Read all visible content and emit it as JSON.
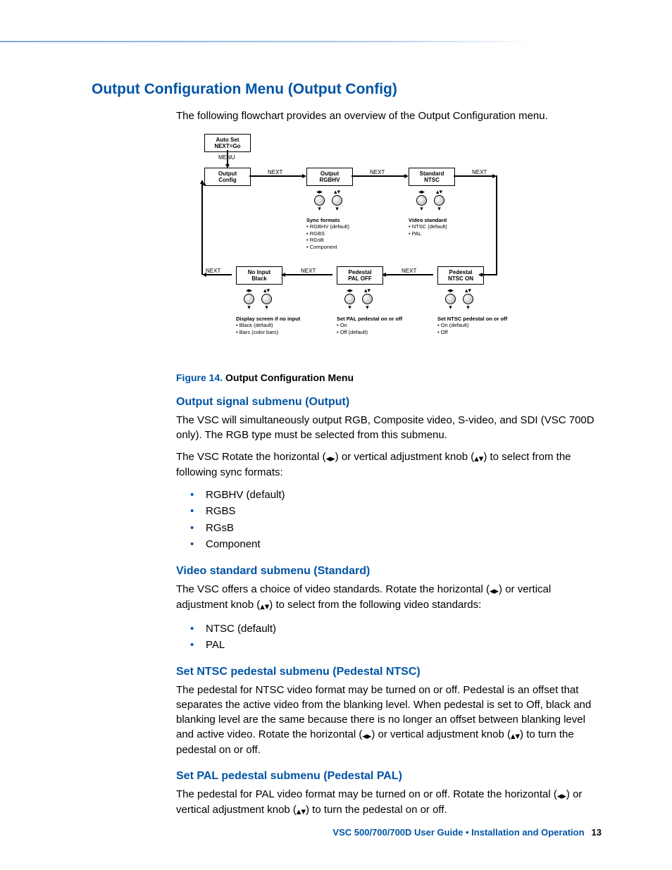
{
  "h1": "Output Configuration Menu (Output Config)",
  "intro": "The following flowchart provides an overview of the Output Configuration menu.",
  "flow": {
    "labels": {
      "next": "NEXT",
      "menu": "MENU"
    },
    "nodes": {
      "autoset": {
        "l1": "Auto Set",
        "l2": "NEXT=Go"
      },
      "output_config": {
        "l1": "Output",
        "l2": "Config"
      },
      "output_rgbhv": {
        "l1": "Output",
        "l2": "RGBHV"
      },
      "standard_ntsc": {
        "l1": "Standard",
        "l2": "NTSC"
      },
      "no_input_black": {
        "l1": "No Input",
        "l2": "Black"
      },
      "pedestal_pal": {
        "l1": "Pedestal",
        "l2": "PAL  OFF"
      },
      "pedestal_ntsc": {
        "l1": "Pedestal",
        "l2": "NTSC  ON"
      }
    },
    "descs": {
      "sync": {
        "title": "Sync formats",
        "items": [
          "RGBHV (default)",
          "RGBS",
          "RGsB",
          "Component"
        ]
      },
      "vstd": {
        "title": "Video standard",
        "items": [
          "NTSC (default)",
          "PAL"
        ]
      },
      "noinput": {
        "title": "Display screen if no input",
        "items": [
          "Black (default)",
          "Bars (color bars)"
        ]
      },
      "ppal": {
        "title": "Set PAL pedestal on or off",
        "items": [
          "On",
          "Off (default)"
        ]
      },
      "pntsc": {
        "title": "Set NTSC pedestal on or off",
        "items": [
          "On (default)",
          "Off"
        ]
      }
    }
  },
  "fig": {
    "lead": "Figure 14. ",
    "title": "Output Configuration Menu"
  },
  "sec1": {
    "h": "Output signal submenu (Output)",
    "p1a": "The VSC will simultaneously output RGB, Composite video, S-video, and SDI (VSC 700D only).  The RGB type must be selected from this submenu.",
    "p2a": "The VSC Rotate the horizontal (",
    "p2b": ") or vertical adjustment knob (",
    "p2c": ") to select from the following sync formats:",
    "items": [
      "RGBHV (default)",
      "RGBS",
      "RGsB",
      "Component"
    ]
  },
  "sec2": {
    "h": "Video standard submenu (Standard)",
    "p1a": "The VSC offers a choice of video standards.  Rotate the horizontal (",
    "p1b": ") or vertical adjustment knob (",
    "p1c": ") to select from the following video standards:",
    "items": [
      "NTSC (default)",
      "PAL"
    ]
  },
  "sec3": {
    "h": "Set NTSC pedestal submenu (Pedestal NTSC)",
    "p1a": "The pedestal for NTSC video format may be turned on or off.  Pedestal is an offset that separates the active video from the blanking level. When pedestal is set to Off, black and blanking level are the same because there is no longer an offset between blanking level and active video. Rotate the horizontal (",
    "p1b": ") or vertical adjustment knob (",
    "p1c": ") to turn the pedestal on or off."
  },
  "sec4": {
    "h": "Set PAL pedestal submenu (Pedestal PAL)",
    "p1a": "The pedestal for PAL video format may be turned on or off. Rotate the horizontal (",
    "p1b": ") or vertical adjustment knob (",
    "p1c": ") to turn the pedestal on or off."
  },
  "footer": {
    "text": "VSC 500/700/700D User Guide • Installation and Operation",
    "page": "13"
  },
  "icons": {
    "h": "◂▸",
    "v": "▴▾"
  }
}
